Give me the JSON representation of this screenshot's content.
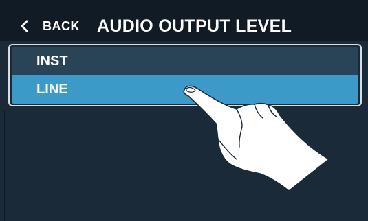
{
  "header": {
    "back_label": "BACK",
    "title": "AUDIO OUTPUT LEVEL"
  },
  "options": [
    {
      "label": "INST",
      "selected": false
    },
    {
      "label": "LINE",
      "selected": true
    }
  ],
  "icons": {
    "back": "chevron-left-icon",
    "gesture": "tap-hand-icon"
  },
  "colors": {
    "background": "#1b2a38",
    "header_background": "#111b25",
    "option_unselected": "#294357",
    "option_selected": "#3c99c8",
    "frame_border": "#d8dde3",
    "text": "#ffffff"
  }
}
